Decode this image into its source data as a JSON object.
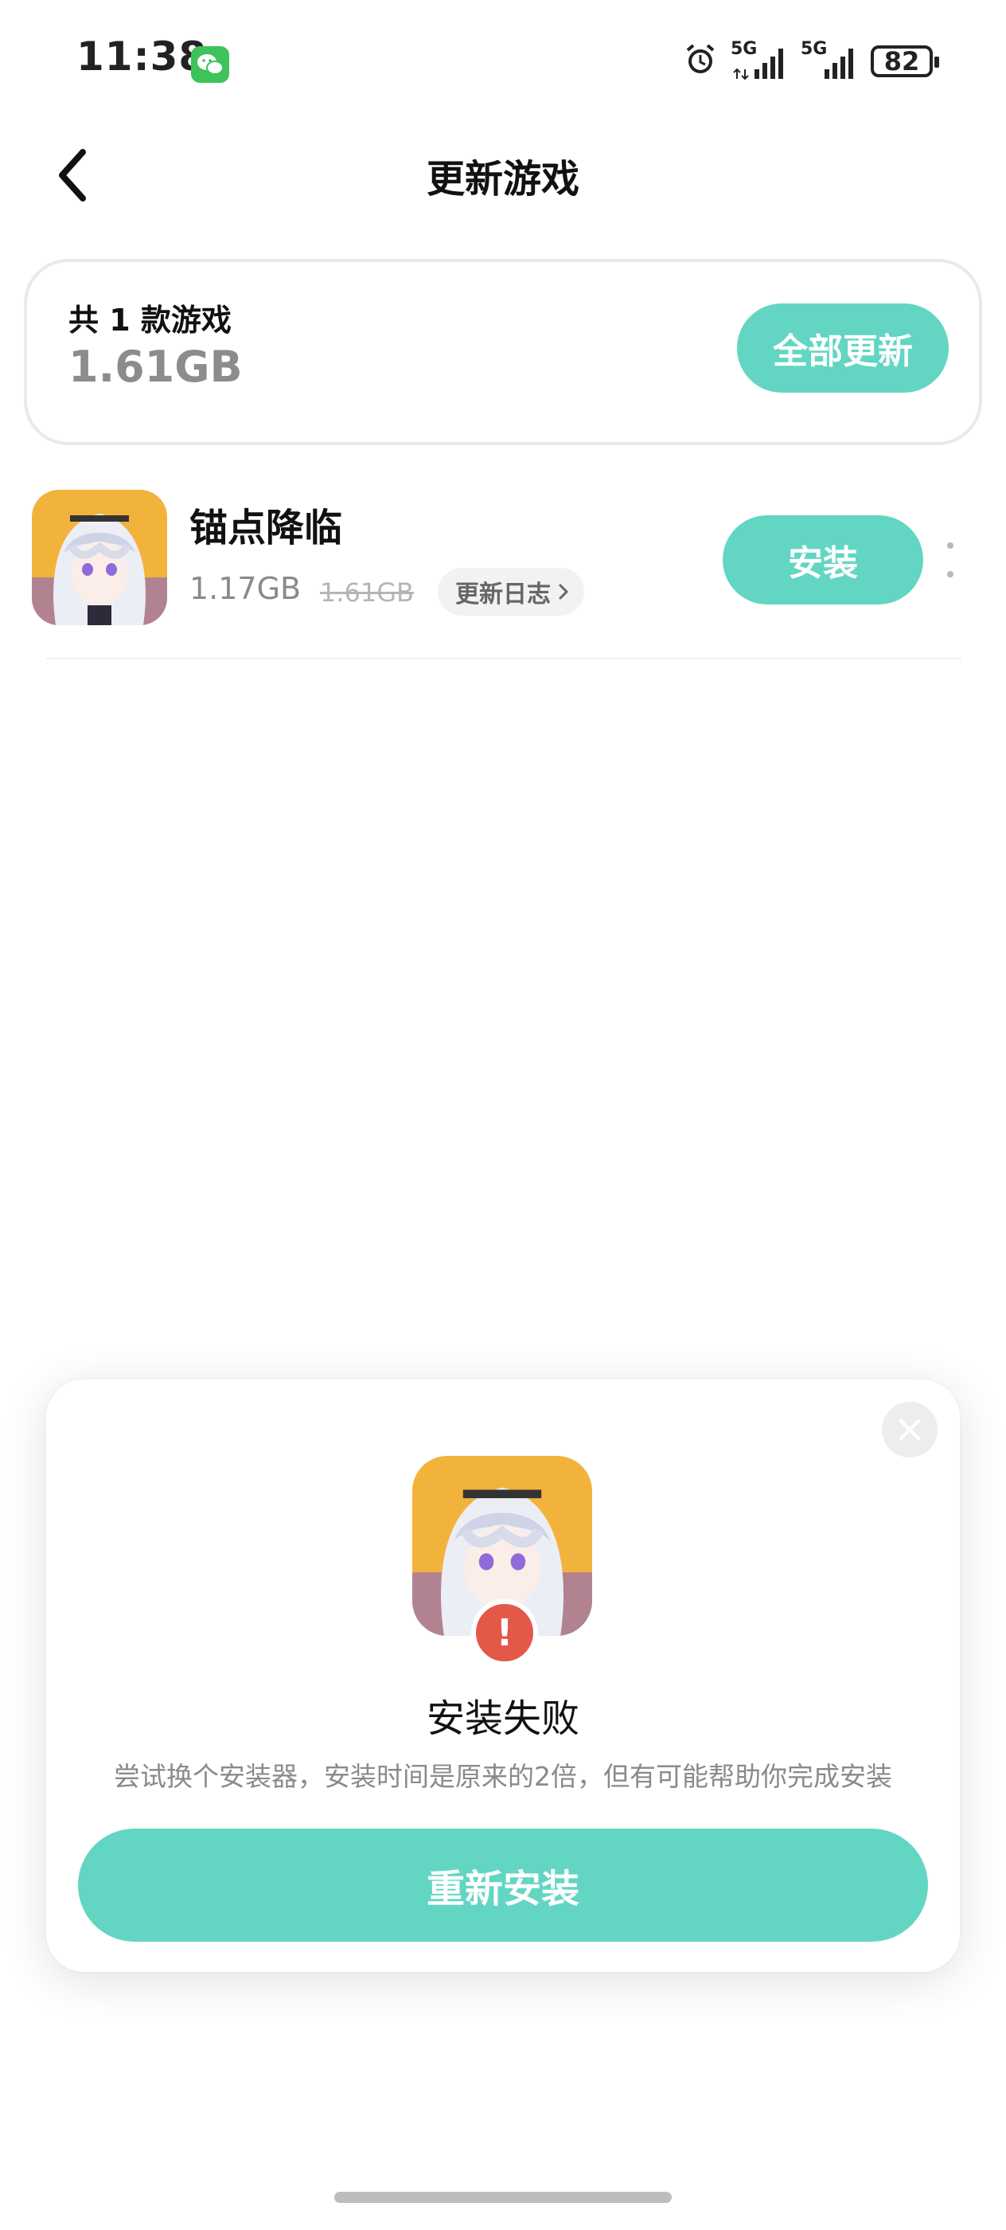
{
  "status_bar": {
    "time": "11:38",
    "battery": "82",
    "network_1": "5G",
    "network_2": "5G",
    "icons": [
      "wechat-icon",
      "alarm-icon",
      "signal-5g-icon",
      "signal-5g-icon",
      "battery-icon"
    ]
  },
  "header": {
    "title": "更新游戏",
    "back_icon": "chevron-left-icon"
  },
  "summary": {
    "count_text": "共 1 款游戏",
    "total_size": "1.61GB",
    "update_all_label": "全部更新"
  },
  "games": [
    {
      "name": "锚点降临",
      "size": "1.17GB",
      "old_size": "1.61GB",
      "changelog_label": "更新日志",
      "install_label": "安装"
    }
  ],
  "dialog": {
    "title": "安装失败",
    "description": "尝试换个安装器，安装时间是原来的2倍，但有可能帮助你完成安装",
    "reinstall_label": "重新安装",
    "error_mark": "!"
  },
  "colors": {
    "accent": "#62d6c2",
    "error": "#e4584a",
    "muted_text": "#8a8a8a"
  }
}
